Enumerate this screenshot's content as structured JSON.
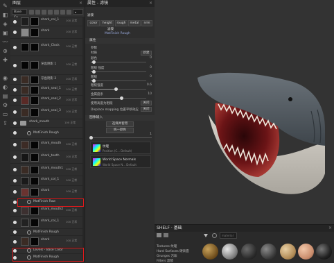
{
  "layers_panel": {
    "title": "图层",
    "channel_select": "Base Co",
    "blend_select": "标准",
    "opacity_select": "100",
    "rows": [
      {
        "name": "shark_col_1",
        "sub": "100 正常"
      },
      {
        "name": "shark",
        "sub": "100 正常"
      },
      {
        "name": "shark_Clock",
        "sub": "100 正常"
      },
      {
        "name": "牙齿阴影 1",
        "sub": "100 正常"
      },
      {
        "name": "牙齿阴影 2",
        "sub": "100 正常"
      },
      {
        "name": "shark_seal_1",
        "sub": "100 正常"
      },
      {
        "name": "shark_seal_2",
        "sub": "100 正常"
      },
      {
        "name": "shark_seal_3",
        "sub": "100 正常"
      },
      {
        "name": "shark_mouth",
        "sub": "100 正常"
      },
      {
        "name": "MatFinish Rough",
        "sub": ""
      },
      {
        "name": "shark_mouth",
        "sub": "100 正常"
      },
      {
        "name": "shark_teeth",
        "sub": "100 正常"
      },
      {
        "name": "shark_mouth1",
        "sub": "100 正常"
      },
      {
        "name": "shark_col_1",
        "sub": "100 正常"
      },
      {
        "name": "shark",
        "sub": "100 正常"
      },
      {
        "name": "MatFinish Raw",
        "sub": ""
      },
      {
        "name": "shark_mouth2",
        "sub": "100 正常"
      },
      {
        "name": "shark_col_1",
        "sub": "100 正常"
      },
      {
        "name": "MatFinish Rough",
        "sub": ""
      },
      {
        "name": "shark",
        "sub": "100 正常"
      },
      {
        "name": "Levels - Base Color",
        "sub": ""
      },
      {
        "name": "MatFinish Rough",
        "sub": ""
      }
    ]
  },
  "properties_panel": {
    "title": "属性 - 滤镜",
    "channels": [
      "color",
      "height",
      "rough",
      "metal",
      "nrm"
    ],
    "filter_label": "滤镜",
    "filter_name": "MatFinish Rough",
    "section_params": "属性",
    "sub_params": "参数",
    "preset_label": "材质",
    "preset_value": "新建",
    "sliders": [
      {
        "label": "颜色",
        "value": "0"
      },
      {
        "label": "粗糙 强度",
        "value": "0"
      },
      {
        "label": "粗糙",
        "value": "0"
      },
      {
        "label": "粗糙强度",
        "value": "0.6"
      },
      {
        "label": "金属度条",
        "value": "10"
      }
    ],
    "toggle1_label": "使用高度为粗糙",
    "toggle1_value": "关闭",
    "toggle2_label": "Displace mapping 位置平移效应",
    "toggle2_value": "关闭",
    "section_inputs": "图像输入",
    "btn_apply": "选择并套用",
    "btn_reset": "统一颜色",
    "slider_small_value": "1",
    "mat1_title": "纹理",
    "mat1_sub": "Position (C... Default)",
    "mat2_title": "World Space Normals",
    "mat2_sub": "World Space N... Default"
  },
  "shelf": {
    "title": "SHELF · 基础",
    "categories": [
      "Textures 纹理",
      "Hard Surfaces 硬表面",
      "Grunges 污垢",
      "Filters 滤镜"
    ],
    "search_placeholder": "material"
  },
  "colors": {
    "highlight_red": "#e0191b",
    "panel_bg": "#2e2e2e",
    "viewport_bg": "#333333"
  }
}
